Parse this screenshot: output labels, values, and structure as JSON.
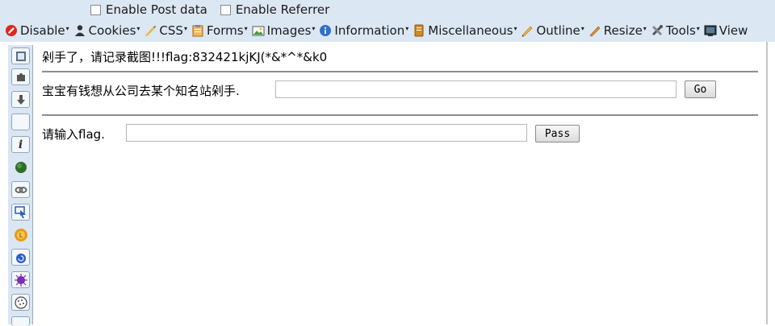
{
  "toolbar": {
    "row1": [
      {
        "label": "Enable Post data",
        "checked": false
      },
      {
        "label": "Enable Referrer",
        "checked": false
      }
    ],
    "menus": [
      {
        "label": "Disable",
        "icon": "disable-icon"
      },
      {
        "label": "Cookies",
        "icon": "cookies-icon"
      },
      {
        "label": "CSS",
        "icon": "css-icon"
      },
      {
        "label": "Forms",
        "icon": "forms-icon"
      },
      {
        "label": "Images",
        "icon": "images-icon"
      },
      {
        "label": "Information",
        "icon": "information-icon"
      },
      {
        "label": "Miscellaneous",
        "icon": "miscellaneous-icon"
      },
      {
        "label": "Outline",
        "icon": "outline-icon"
      },
      {
        "label": "Resize",
        "icon": "resize-icon"
      },
      {
        "label": "Tools",
        "icon": "tools-icon"
      },
      {
        "label": "View",
        "icon": "view-icon"
      }
    ]
  },
  "page": {
    "flag_line": "剁手了，请记录截图!!!flag:832421kjKJ(*&*^*&k0",
    "question1": "宝宝有钱想从公司去某个知名站剁手.",
    "input1_value": "",
    "go_label": "Go",
    "question2": "请输入flag.",
    "input2_value": "",
    "pass_label": "Pass"
  },
  "sidebar_icons": [
    "web-icon",
    "puzzle-icon",
    "download-icon",
    "blank-icon",
    "info-icon",
    "green-ball-icon",
    "link-icon",
    "cursor-icon",
    "orange-icon",
    "swirl-icon",
    "purple-icon",
    "cookie-icon"
  ]
}
